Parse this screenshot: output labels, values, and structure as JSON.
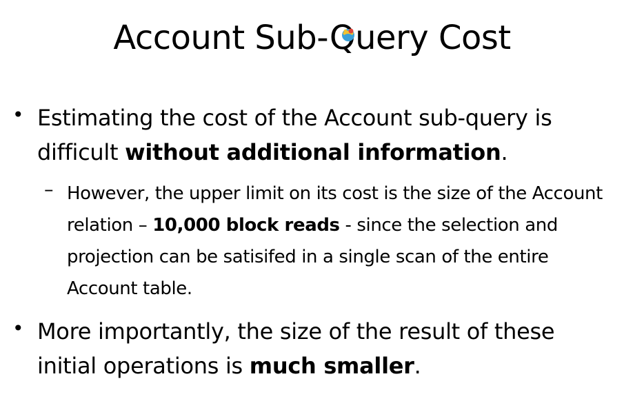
{
  "slide": {
    "title": "Account Sub-Query Cost",
    "bullets": [
      {
        "marker": "•",
        "text_1": "Estimating the cost of the Account sub-query is difficult ",
        "bold_1": "without additional information",
        "text_2": "."
      },
      {
        "marker": "–",
        "text_1": "However, the upper limit on its cost is the size of the Account relation – ",
        "bold_1": "10,000 block reads",
        "text_2": " - since the selection and projection can be satisifed in a single scan of the entire Account table."
      },
      {
        "marker": "•",
        "text_1": "More importantly, the size of the result of these initial operations is ",
        "bold_1": "much smaller",
        "text_2": "."
      }
    ]
  },
  "colors": {
    "background": "#ffffff",
    "text": "#000000",
    "sticker_yellow": "#f2c230",
    "sticker_blue": "#3aa0d8",
    "sticker_red": "#e0453a"
  },
  "icons": {
    "title_overlay": "paint-bucket-icon"
  }
}
